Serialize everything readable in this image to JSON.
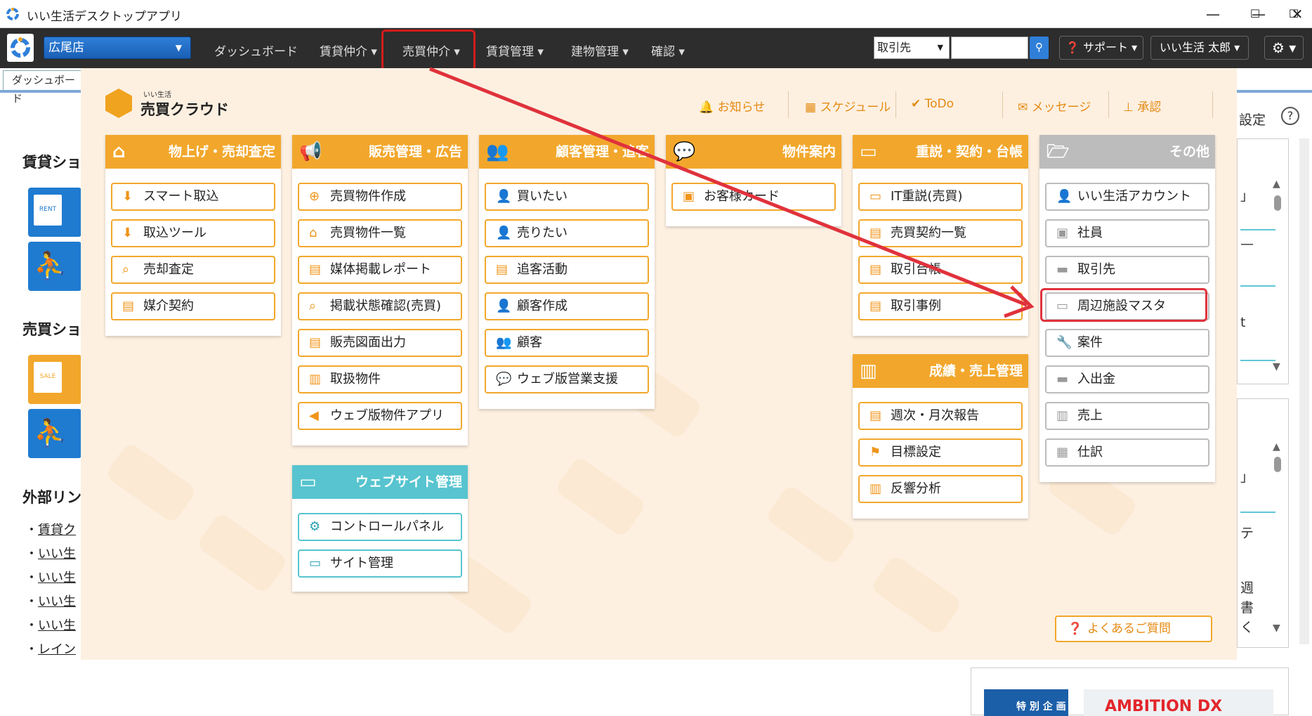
{
  "window": {
    "title": "いい生活デスクトップアプリ",
    "minimize": "—",
    "maximize": "☐",
    "close": "✕"
  },
  "nav": {
    "store": "広尾店",
    "items": [
      "ダッシュボード",
      "賃貸仲介",
      "売買仲介",
      "賃貸管理",
      "建物管理",
      "確認"
    ],
    "trade_select": "取引先",
    "support": "サポート",
    "user": "いい生活 太郎",
    "settings_icon": "gear-icon"
  },
  "background": {
    "tab": "ダッシュボード",
    "sections": [
      "賃貸ショ",
      "売買ショ",
      "外部リン"
    ],
    "badges": [
      "RENT",
      "SALE"
    ],
    "links": [
      "賃貸ク",
      "いい生",
      "いい生",
      "いい生",
      "いい生",
      "レイン"
    ],
    "settings_label": "設定",
    "help": "?",
    "right_chars": [
      "」",
      "—",
      "t",
      "」",
      "テ",
      "週",
      "書",
      "く"
    ],
    "banner": {
      "left": "特 別 企 画",
      "right": "AMBITION DX"
    }
  },
  "menu": {
    "brand_small": "いい生活",
    "brand_big": "売買クラウド",
    "toplinks": [
      {
        "icon": "bell-icon",
        "label": "お知らせ"
      },
      {
        "icon": "calendar-icon",
        "label": "スケジュール"
      },
      {
        "icon": "check-icon",
        "label": "ToDo"
      },
      {
        "icon": "envelope-icon",
        "label": "メッセージ"
      },
      {
        "icon": "stamp-icon",
        "label": "承認"
      }
    ],
    "columns": [
      {
        "header": "物上げ・売却査定",
        "items": [
          "スマート取込",
          "取込ツール",
          "売却査定",
          "媒介契約"
        ]
      },
      {
        "header": "販売管理・広告",
        "items": [
          "売買物件作成",
          "売買物件一覧",
          "媒体掲載レポート",
          "掲載状態確認(売買)",
          "販売図面出力",
          "取扱物件",
          "ウェブ版物件アプリ"
        ]
      },
      {
        "header": "顧客管理・追客",
        "items": [
          "買いたい",
          "売りたい",
          "追客活動",
          "顧客作成",
          "顧客",
          "ウェブ版営業支援"
        ]
      },
      {
        "header": "物件案内",
        "items": [
          "お客様カード"
        ]
      },
      {
        "header": "重説・契約・台帳",
        "items": [
          "IT重説(売買)",
          "売買契約一覧",
          "取引台帳",
          "取引事例"
        ]
      },
      {
        "header": "成績・売上管理",
        "items": [
          "週次・月次報告",
          "目標設定",
          "反響分析"
        ]
      },
      {
        "header": "その他",
        "items": [
          "いい生活アカウント",
          "社員",
          "取引先",
          "周辺施設マスタ",
          "案件",
          "入出金",
          "売上",
          "仕訳"
        ]
      },
      {
        "header": "ウェブサイト管理",
        "items": [
          "コントロールパネル",
          "サイト管理"
        ]
      }
    ],
    "faq": "よくあるご質問"
  },
  "annotation": {
    "color": "#e0323c"
  }
}
